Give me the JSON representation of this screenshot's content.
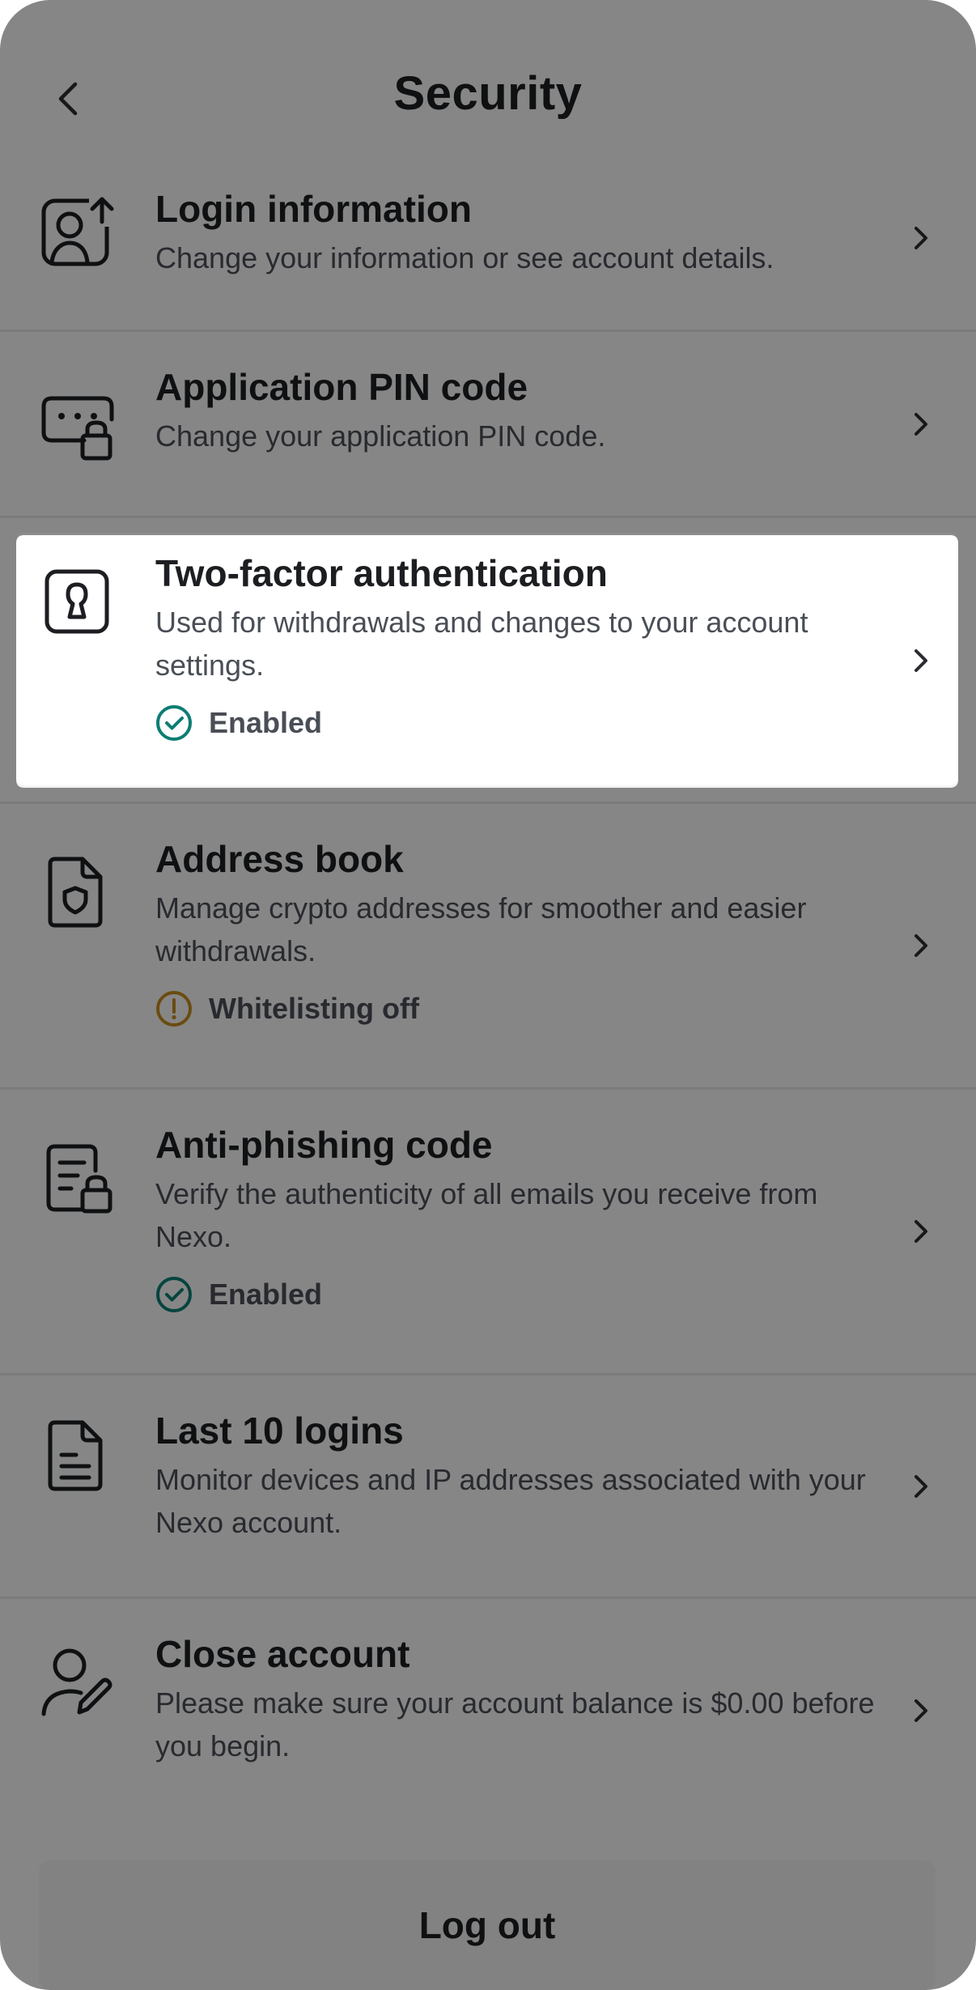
{
  "header": {
    "title": "Security"
  },
  "items": [
    {
      "title": "Login information",
      "desc": "Change your information or see account details.",
      "icon": "user-upload-icon"
    },
    {
      "title": "Application PIN code",
      "desc": "Change your application PIN code.",
      "icon": "pin-lock-icon"
    },
    {
      "title": "Two-factor authentication",
      "desc": "Used for withdrawals and changes to your account settings.",
      "status": "Enabled",
      "status_icon": "check-circle-icon",
      "status_color": "#0d7d73",
      "icon": "keyhole-icon"
    },
    {
      "title": "Address book",
      "desc": "Manage crypto addresses for smoother and easier withdrawals.",
      "status": "Whitelisting off",
      "status_icon": "warning-circle-icon",
      "status_color": "#c28a1e",
      "icon": "shield-document-icon"
    },
    {
      "title": "Anti-phishing code",
      "desc": "Verify the authenticity of all emails you receive from Nexo.",
      "status": "Enabled",
      "status_icon": "check-circle-icon",
      "status_color": "#0d7d73",
      "icon": "locked-document-icon"
    },
    {
      "title": "Last 10 logins",
      "desc": "Monitor devices and IP addresses associated with your Nexo account.",
      "icon": "document-list-icon"
    },
    {
      "title": "Close account",
      "desc": "Please make sure your account balance is $0.00 before you begin.",
      "icon": "user-edit-icon"
    }
  ],
  "footer": {
    "logout_label": "Log out"
  },
  "colors": {
    "overlay": "rgba(0,0,0,0.45)",
    "enabled": "#0d7d73",
    "warning": "#c28a1e"
  }
}
